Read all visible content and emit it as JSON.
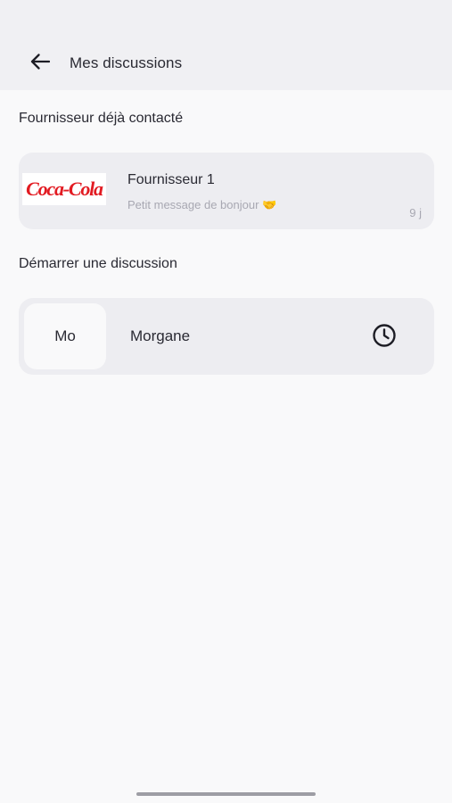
{
  "header": {
    "title": "Mes discussions",
    "back_icon": "arrow-left-icon"
  },
  "contacted_section": {
    "title": "Fournisseur déjà contacté",
    "items": [
      {
        "logo_text": "Coca-Cola",
        "logo_color": "#e21b22",
        "name": "Fournisseur 1",
        "preview": "Petit message de bonjour 🤝",
        "time": "9 j"
      }
    ]
  },
  "start_section": {
    "title": "Démarrer une discussion",
    "items": [
      {
        "avatar_initials": "Mo",
        "name": "Morgane",
        "action_icon": "clock-icon"
      }
    ]
  }
}
